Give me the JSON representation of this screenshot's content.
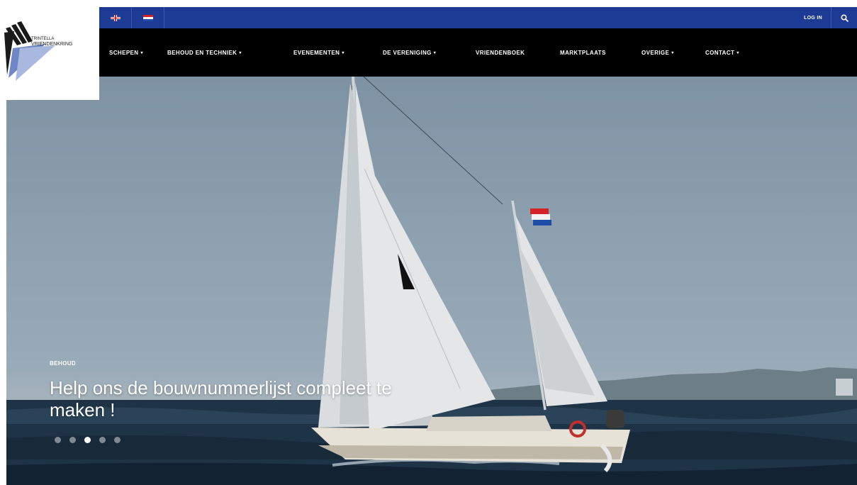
{
  "topbar": {
    "languages": [
      {
        "name": "english",
        "flag": "uk-flag-icon"
      },
      {
        "name": "dutch",
        "flag": "nl-flag-icon"
      }
    ],
    "login_label": "LOG IN",
    "search_icon": "search-icon",
    "background_color": "#1d3a94"
  },
  "logo": {
    "text_line1": "TRINTELLA",
    "text_line2": "VRIENDENKRING"
  },
  "nav": {
    "background_color": "#000000",
    "items": [
      {
        "label": "SCHEPEN",
        "dropdown": true
      },
      {
        "label": "BEHOUD EN TECHNIEK",
        "dropdown": true
      },
      {
        "label": "EVENEMENTEN",
        "dropdown": true
      },
      {
        "label": "DE VERENIGING",
        "dropdown": true
      },
      {
        "label": "VRIENDENBOEK",
        "dropdown": false
      },
      {
        "label": "MARKTPLAATS",
        "dropdown": false
      },
      {
        "label": "OVERIGE",
        "dropdown": true
      },
      {
        "label": "CONTACT",
        "dropdown": true
      }
    ],
    "caret": "▾"
  },
  "hero": {
    "category": "BEHOUD",
    "title": "Help ons de bouwnummerlijst compleet te maken !",
    "slide_count": 5,
    "active_slide": 3
  }
}
